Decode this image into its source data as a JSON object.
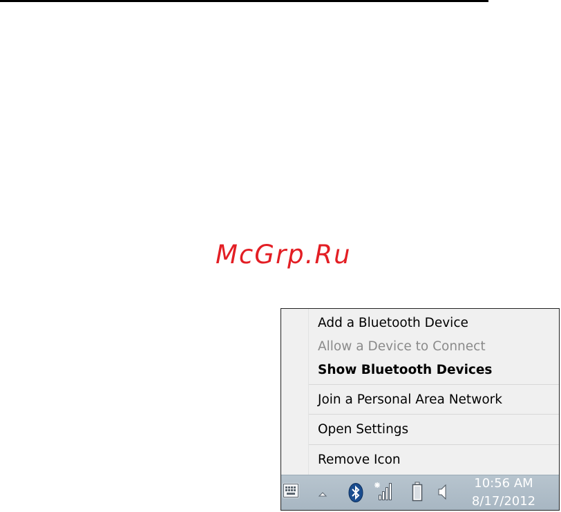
{
  "watermark": "McGrp.Ru",
  "context_menu": {
    "items": [
      {
        "label": "Add a Bluetooth Device",
        "state": "enabled"
      },
      {
        "label": "Allow a Device to Connect",
        "state": "disabled"
      },
      {
        "label": "Show Bluetooth Devices",
        "state": "default"
      },
      {
        "label": "Join a Personal Area Network",
        "state": "enabled"
      },
      {
        "label": "Open Settings",
        "state": "enabled"
      },
      {
        "label": "Remove Icon",
        "state": "enabled"
      }
    ]
  },
  "taskbar": {
    "icons": [
      "touch-keyboard-icon",
      "show-hidden-icons-icon",
      "bluetooth-icon",
      "network-signal-icon",
      "battery-icon",
      "volume-icon"
    ],
    "clock": {
      "time": "10:56 AM",
      "date": "8/17/2012"
    }
  },
  "colors": {
    "watermark": "#e31e24",
    "bluetooth": "#1a4d8f",
    "taskbar": "#b1bfca"
  }
}
